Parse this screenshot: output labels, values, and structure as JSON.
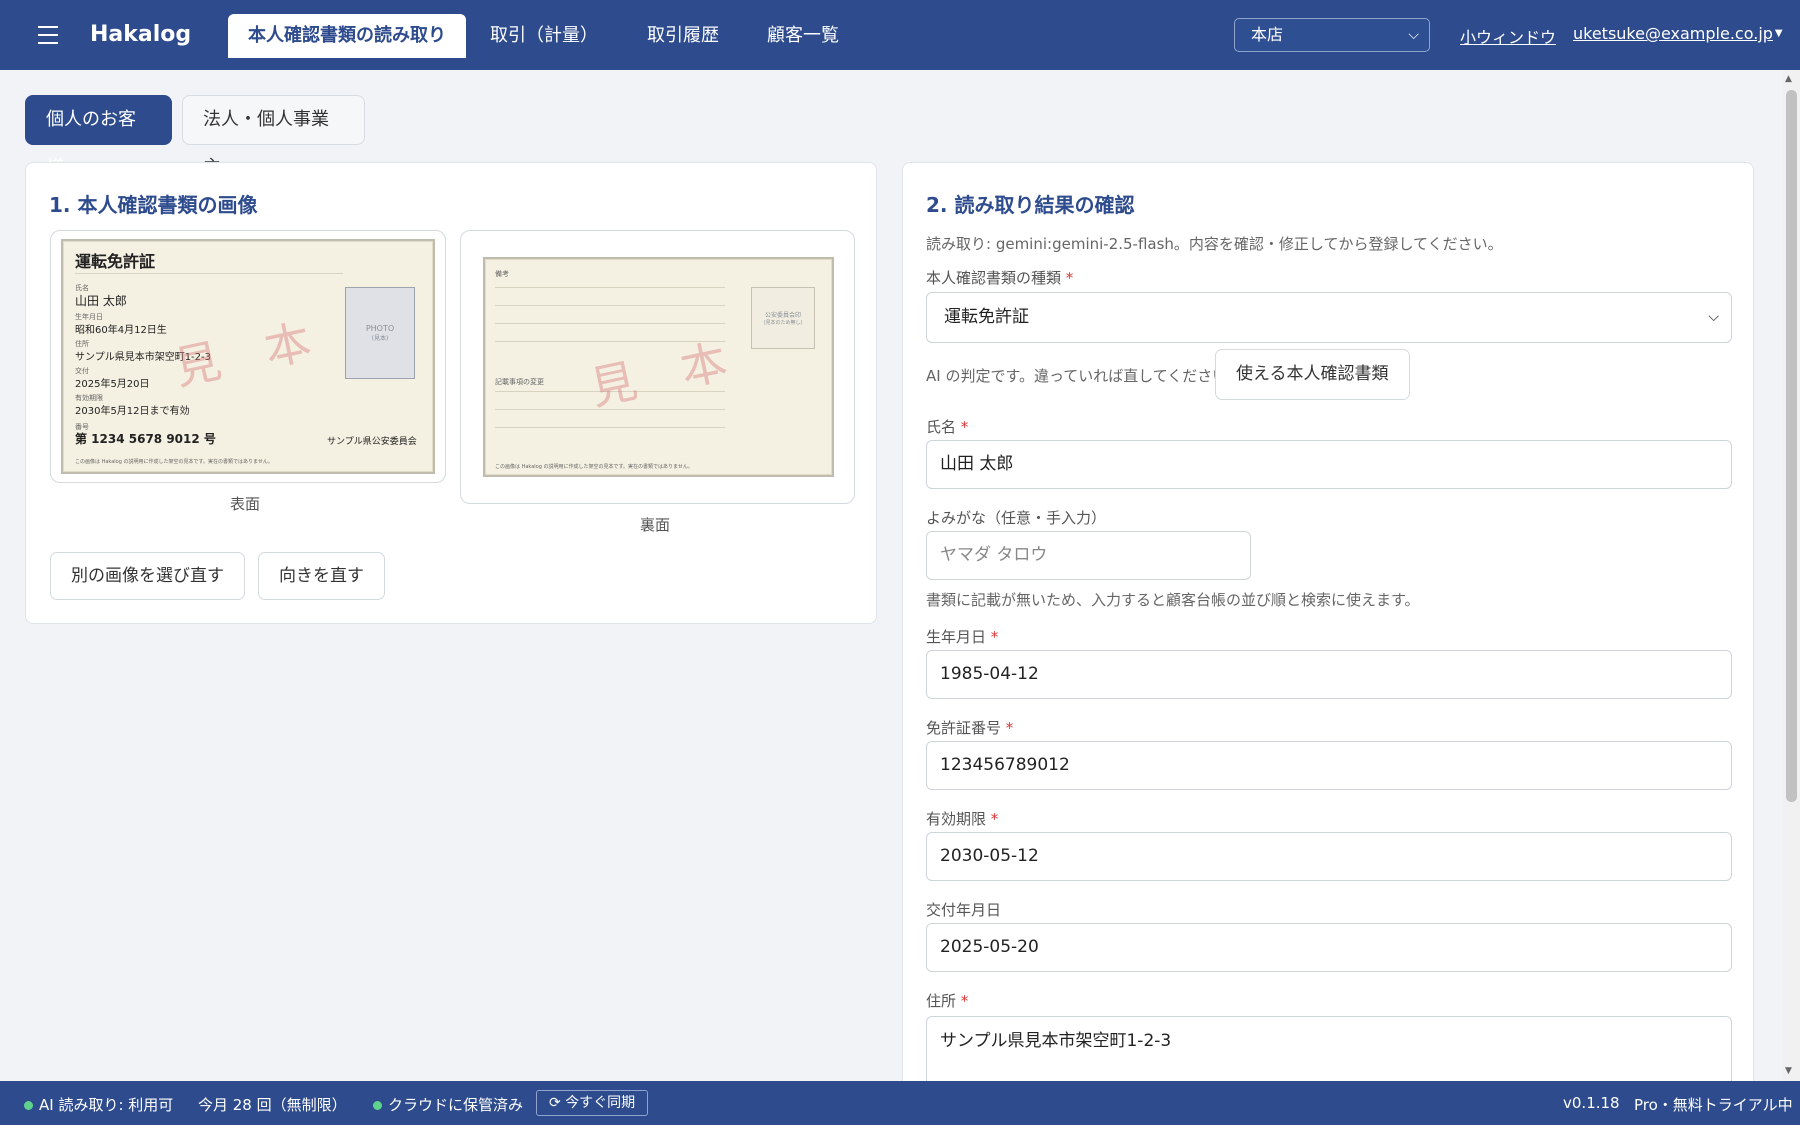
{
  "topbar": {
    "brand": "Hakalog",
    "tabs": [
      {
        "label": "本人確認書類の読み取り",
        "active": true
      },
      {
        "label": "取引（計量）"
      },
      {
        "label": "取引履歴"
      },
      {
        "label": "顧客一覧"
      }
    ],
    "store": "本店",
    "small_window": "小ウィンドウ",
    "user": "uketsuke@example.co.jp"
  },
  "mode": {
    "individual": "個人のお客様",
    "corporate": "法人・個人事業主"
  },
  "left": {
    "title": "1. 本人確認書類の画像",
    "front": {
      "card_title": "運転免許証",
      "name_label": "氏名",
      "name": "山田 太郎",
      "birth_label": "生年月日",
      "birth": "昭和60年4月12日生",
      "address_label": "住所",
      "address": "サンプル県見本市架空町1-2-3",
      "issue_label": "交付",
      "issue": "2025年5月20日",
      "expiry_label": "有効期限",
      "expiry": "2030年5月12日まで有効",
      "number_label": "番号",
      "number": "第 1234 5678 9012 号",
      "photo": "PHOTO",
      "photo_sub": "(見本)",
      "issuer": "サンプル県公安委員会",
      "watermark": "見　本",
      "disclaimer": "この画像は Hakalog の説明用に作成した架空の見本です。実在の書類ではありません。"
    },
    "back": {
      "remarks_label": "備考",
      "change_label": "記載事項の変更",
      "stamp": "公安委員会印",
      "stamp_sub": "(見本のため無し)",
      "watermark": "見　本",
      "disclaimer": "この画像は Hakalog の説明用に作成した架空の見本です。実在の書類ではありません。"
    },
    "front_caption": "表面",
    "back_caption": "裏面",
    "reselect_button": "別の画像を選び直す",
    "rotate_button": "向きを直す"
  },
  "right": {
    "title": "2. 読み取り結果の確認",
    "read_note": "読み取り: gemini:gemini-2.5-flash。内容を確認・修正してから登録してください。",
    "doc_type_label": "本人確認書類の種類",
    "doc_type_value": "運転免許証",
    "ai_note": "AI の判定です。違っていれば直してください。",
    "usable_docs_button": "使える本人確認書類",
    "name_label": "氏名",
    "name_value": "山田 太郎",
    "kana_label": "よみがな（任意・手入力）",
    "kana_placeholder": "ヤマダ タロウ",
    "kana_note": "書類に記載が無いため、入力すると顧客台帳の並び順と検索に使えます。",
    "birth_label": "生年月日",
    "birth_value": "1985-04-12",
    "license_label": "免許証番号",
    "license_value": "123456789012",
    "expiry_label": "有効期限",
    "expiry_value": "2030-05-12",
    "issue_label": "交付年月日",
    "issue_value": "2025-05-20",
    "address_label": "住所",
    "address_value": "サンプル県見本市架空町1-2-3",
    "required_mark": "*"
  },
  "status": {
    "ai": "AI 読み取り: 利用可",
    "count": "今月 28 回（無制限）",
    "cloud": "クラウドに保管済み",
    "sync": "今すぐ同期",
    "version": "v0.1.18",
    "plan": "Pro・無料トライアル中"
  },
  "colors": {
    "brand": "#2d4b8d",
    "status_dot": "#5fd38d",
    "required": "#d33333"
  }
}
